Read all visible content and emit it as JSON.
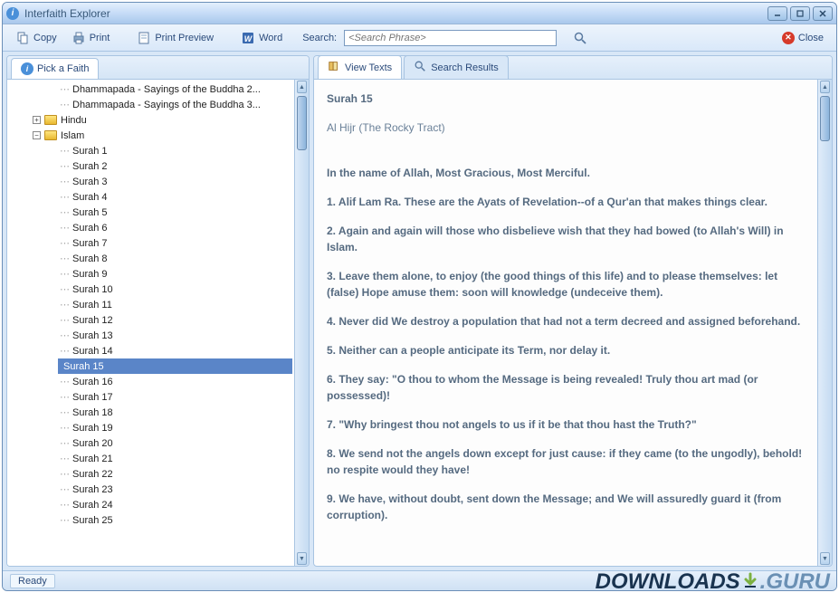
{
  "window": {
    "title": "Interfaith Explorer"
  },
  "toolbar": {
    "copy": "Copy",
    "print": "Print",
    "preview": "Print Preview",
    "word": "Word",
    "search_label": "Search:",
    "search_placeholder": "<Search Phrase>",
    "close": "Close"
  },
  "left": {
    "tab": "Pick a Faith",
    "top_items": [
      "Dhammapada - Sayings of the Buddha 2...",
      "Dhammapada - Sayings of the Buddha 3..."
    ],
    "folders": [
      "Hindu",
      "Islam"
    ],
    "surah_prefix": "Surah",
    "surah_start": 1,
    "surah_end": 25,
    "selected_surah": 15
  },
  "right": {
    "tabs": {
      "view": "View Texts",
      "search": "Search Results"
    },
    "content": {
      "title": "Surah 15",
      "subtitle": "Al Hijr (The Rocky Tract)",
      "intro": "In the name of Allah, Most Gracious, Most Merciful.",
      "verses": [
        "1. Alif Lam Ra. These are the Ayats of Revelation--of a Qur'an that makes things clear.",
        "2. Again and again will those who disbelieve wish that they had bowed (to Allah's Will) in Islam.",
        "3. Leave them alone, to enjoy (the good things of this life) and to please themselves: let (false) Hope amuse them: soon will knowledge (undeceive them).",
        "4. Never did We destroy a population that had not a term decreed and assigned beforehand.",
        "5. Neither can a people anticipate its Term, nor delay it.",
        "6. They say: \"O thou to whom the Message is being revealed! Truly thou art mad (or possessed)!",
        "7. \"Why bringest thou not angels to us if it be that thou hast the Truth?\"",
        "8. We send not the angels down except for just cause: if they came (to the ungodly), behold! no respite would they have!",
        "9. We have, without doubt, sent down the Message; and We will assuredly guard it (from corruption)."
      ]
    }
  },
  "status": {
    "text": "Ready"
  },
  "watermark": {
    "a": "DOWNLOADS",
    "b": ".GURU"
  }
}
